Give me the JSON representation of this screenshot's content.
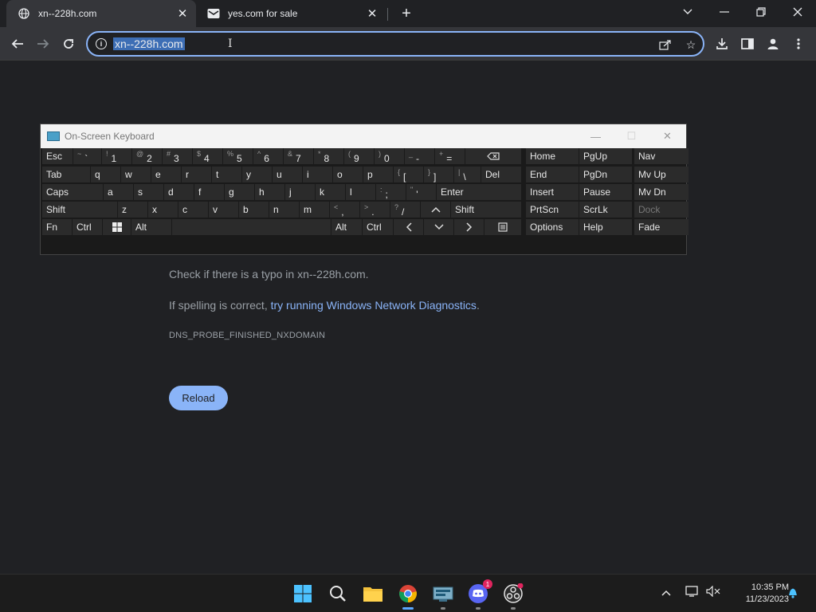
{
  "browser": {
    "tabs": [
      {
        "title": "xn--228h.com",
        "favicon": "globe-icon",
        "active": true
      },
      {
        "title": "yes.com for sale",
        "favicon": "mail-icon",
        "active": false
      }
    ],
    "address": {
      "url": "xn--228h.com"
    }
  },
  "page": {
    "typo_hint": "Check if there is a typo in xn--228h.com.",
    "spelling_prefix": "If spelling is correct, ",
    "diagnostics_link": "try running Windows Network Diagnostics",
    "spelling_suffix": ".",
    "error_code": "DNS_PROBE_FINISHED_NXDOMAIN",
    "reload_label": "Reload"
  },
  "osk": {
    "title": "On-Screen Keyboard",
    "keys": {
      "esc": "Esc",
      "tab": "Tab",
      "caps": "Caps",
      "shift_l": "Shift",
      "fn": "Fn",
      "ctrl_l": "Ctrl",
      "alt_l": "Alt",
      "backtick": {
        "s": "~",
        "m": "`"
      },
      "n1": {
        "s": "!",
        "m": "1"
      },
      "n2": {
        "s": "@",
        "m": "2"
      },
      "n3": {
        "s": "#",
        "m": "3"
      },
      "n4": {
        "s": "$",
        "m": "4"
      },
      "n5": {
        "s": "%",
        "m": "5"
      },
      "n6": {
        "s": "^",
        "m": "6"
      },
      "n7": {
        "s": "&",
        "m": "7"
      },
      "n8": {
        "s": "*",
        "m": "8"
      },
      "n9": {
        "s": "(",
        "m": "9"
      },
      "n0": {
        "s": ")",
        "m": "0"
      },
      "minus": {
        "s": "_",
        "m": "-"
      },
      "equals": {
        "s": "+",
        "m": "="
      },
      "q": "q",
      "w": "w",
      "e": "e",
      "r": "r",
      "t": "t",
      "y": "y",
      "u": "u",
      "i": "i",
      "o": "o",
      "p": "p",
      "lbracket": {
        "s": "{",
        "m": "["
      },
      "rbracket": {
        "s": "}",
        "m": "]"
      },
      "backslash": {
        "s": "|",
        "m": "\\"
      },
      "del": "Del",
      "a": "a",
      "s": "s",
      "d": "d",
      "f": "f",
      "g": "g",
      "h": "h",
      "j": "j",
      "k": "k",
      "l": "l",
      "semicolon": {
        "s": ":",
        "m": ";"
      },
      "quote": {
        "s": "\"",
        "m": "'"
      },
      "enter": "Enter",
      "z": "z",
      "x": "x",
      "c": "c",
      "v": "v",
      "b": "b",
      "n": "n",
      "m": "m",
      "comma": {
        "s": "<",
        "m": ","
      },
      "period": {
        "s": ">",
        "m": "."
      },
      "slash": {
        "s": "?",
        "m": "/"
      },
      "shift_r": "Shift",
      "alt_r": "Alt",
      "ctrl_r": "Ctrl",
      "home": "Home",
      "pgup": "PgUp",
      "nav": "Nav",
      "end": "End",
      "pgdn": "PgDn",
      "mvup": "Mv Up",
      "insert": "Insert",
      "pause": "Pause",
      "mvdn": "Mv Dn",
      "prtscn": "PrtScn",
      "scrlk": "ScrLk",
      "dock": "Dock",
      "options": "Options",
      "help": "Help",
      "fade": "Fade"
    }
  },
  "taskbar": {
    "apps": [
      "start-icon",
      "search-icon",
      "file-explorer-icon",
      "chrome-icon",
      "screen-app-icon",
      "discord-icon",
      "obs-icon"
    ],
    "discord_badge": "1",
    "time": "10:35 PM",
    "date": "11/23/2023"
  },
  "colors": {
    "accent": "#8ab4f8",
    "background": "#202124",
    "toolbar": "#35363a"
  }
}
